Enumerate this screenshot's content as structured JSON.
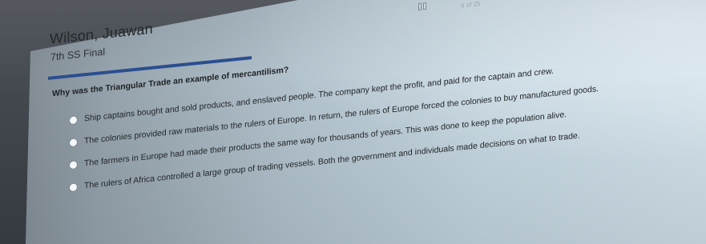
{
  "top_bar": {
    "pause_icon": "pause-icon",
    "question_counter": "6 of 25"
  },
  "header": {
    "student_name": "Wilson, Juawan",
    "assessment_title": "7th SS Final"
  },
  "question": {
    "prompt": "Why was the Triangular Trade an example of mercantilism?",
    "options": [
      {
        "label": "Ship captains bought and sold products, and enslaved people. The company kept the profit, and paid for the captain and crew.",
        "checked": false
      },
      {
        "label": "The colonies provided raw materials to the rulers of Europe. In return, the rulers of Europe forced the colonies to buy manufactured goods.",
        "checked": false
      },
      {
        "label": "The farmers in Europe had made their products the same way for thousands of years. This was done to keep the population alive.",
        "checked": false
      },
      {
        "label": "The rulers of Africa controlled a large group of trading vessels. Both the government and individuals made decisions on what to trade.",
        "checked": false
      }
    ]
  },
  "colors": {
    "accent": "#2b4e90",
    "text": "#212529",
    "screen_light": "#d3e2eb"
  }
}
